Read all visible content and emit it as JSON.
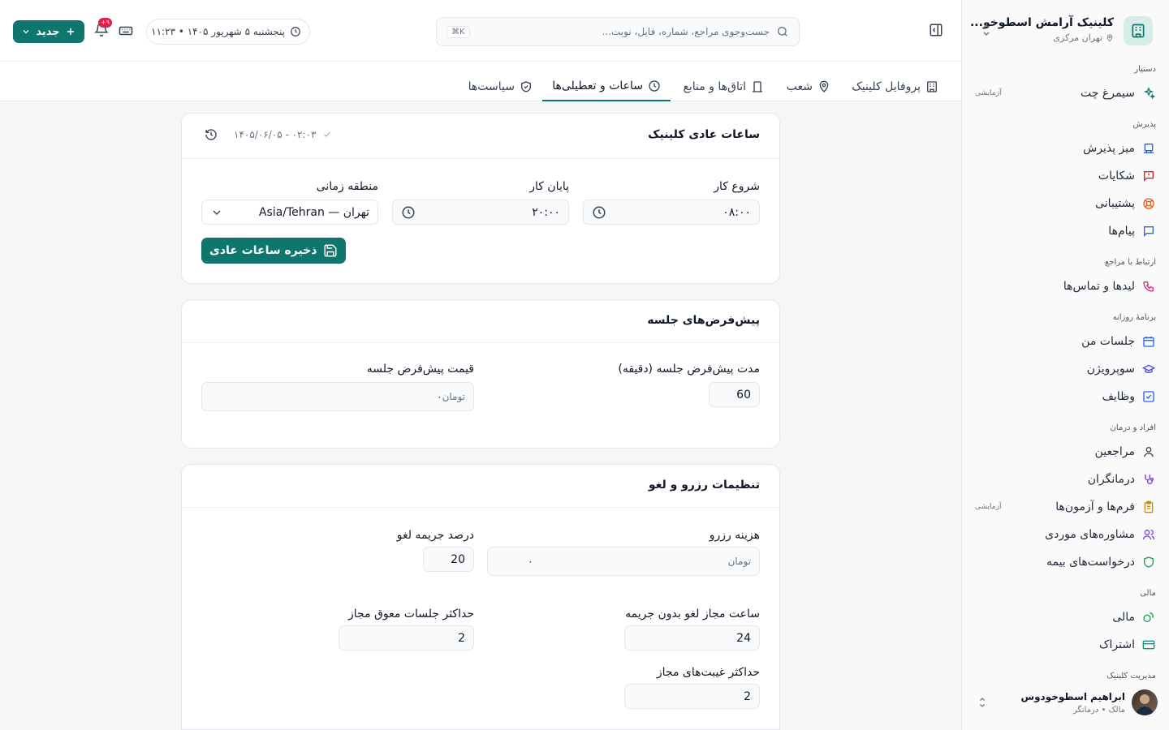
{
  "sidebar": {
    "brand_name": "کلینیک آرامش اسطوخو...",
    "brand_sub": "تهران مرکزی",
    "sections": [
      {
        "title": "دستیار",
        "items": [
          {
            "label": "سیمرغ چت",
            "badge": "آزمایشی",
            "icon": "sparkles-icon",
            "color": "#0f766e"
          }
        ]
      },
      {
        "title": "پذیرش",
        "items": [
          {
            "label": "میز پذیرش",
            "icon": "desk-icon",
            "color": "#2563eb"
          },
          {
            "label": "شکایات",
            "icon": "alert-message-icon",
            "color": "#dc2626"
          },
          {
            "label": "پشتیبانی",
            "icon": "lifebuoy-icon",
            "color": "#ea580c"
          },
          {
            "label": "پیام‌ها",
            "icon": "message-icon",
            "color": "#2563eb"
          }
        ]
      },
      {
        "title": "ارتباط با مراجع",
        "items": [
          {
            "label": "لیدها و تماس‌ها",
            "icon": "phone-icon",
            "color": "#db2777"
          }
        ]
      },
      {
        "title": "برنامهٔ روزانه",
        "items": [
          {
            "label": "جلسات من",
            "icon": "calendar-icon",
            "color": "#2563eb"
          },
          {
            "label": "سوپرویژن",
            "icon": "graduation-cap-icon",
            "color": "#4f46e5"
          },
          {
            "label": "وظایف",
            "icon": "checkbox-icon",
            "color": "#2563eb"
          }
        ]
      },
      {
        "title": "افراد و درمان",
        "items": [
          {
            "label": "مراجعین",
            "icon": "user-icon",
            "color": "#374151"
          },
          {
            "label": "درمانگران",
            "icon": "stethoscope-icon",
            "color": "#7c3aed"
          },
          {
            "label": "فرم‌ها و آزمون‌ها",
            "badge": "آزمایشی",
            "icon": "clipboard-icon",
            "color": "#ca8a04"
          },
          {
            "label": "مشاوره‌های موردی",
            "icon": "users-icon",
            "color": "#7c3aed"
          },
          {
            "label": "درخواست‌های بیمه",
            "icon": "shield-icon",
            "color": "#16a34a"
          }
        ]
      },
      {
        "title": "مالی",
        "items": [
          {
            "label": "مالی",
            "icon": "coins-icon",
            "color": "#16a34a"
          },
          {
            "label": "اشتراک",
            "icon": "credit-card-icon",
            "color": "#0d9488"
          }
        ]
      },
      {
        "title": "مدیریت کلینیک",
        "items": []
      }
    ],
    "user": {
      "name": "ابراهیم اسطوخودوس",
      "role": "مالک • درمانگر"
    }
  },
  "topbar": {
    "search_placeholder": "جست‌وجوی مراجع، شماره، فایل، نوبت...",
    "search_shortcut": "⌘K",
    "date_text": "پنجشنبه ۵ شهریور ۱۴۰۵ • ۱۱:۲۳",
    "notif_count": "۹+",
    "new_label": "جدید"
  },
  "tabs": [
    {
      "label": "پروفایل کلینیک",
      "icon": "building-icon",
      "active": false
    },
    {
      "label": "شعب",
      "icon": "map-pin-icon",
      "active": false
    },
    {
      "label": "اتاق‌ها و منابع",
      "icon": "door-icon",
      "active": false
    },
    {
      "label": "ساعات و تعطیلی‌ها",
      "icon": "clock-icon",
      "active": true
    },
    {
      "label": "سیاست‌ها",
      "icon": "shield-check-icon",
      "active": false
    }
  ],
  "hours_card": {
    "title": "ساعات عادی کلینیک",
    "last_saved": "۱۴۰۵/۰۶/۰۵ - ۰۲:۰۳",
    "start_label": "شروع کار",
    "start_value": "۰۸:۰۰",
    "end_label": "پایان کار",
    "end_value": "۲۰:۰۰",
    "tz_label": "منطقه زمانی",
    "tz_value": "تهران — Asia/Tehran",
    "save_label": "ذخیره ساعات عادی"
  },
  "session_card": {
    "title": "پیش‌فرض‌های جلسه",
    "duration_label": "مدت پیش‌فرض جلسه (دقیقه)",
    "duration_value": "60",
    "price_label": "قیمت پیش‌فرض جلسه",
    "price_value": "۰",
    "price_unit": "تومان"
  },
  "booking_card": {
    "title": "تنظیمات رزرو و لغو",
    "fee_label": "هزینه رزرو",
    "fee_value": "۰",
    "fee_unit": "تومان",
    "penalty_label": "درصد جریمه لغو",
    "penalty_value": "20",
    "free_cancel_label": "ساعت مجاز لغو بدون جریمه",
    "free_cancel_value": "24",
    "max_pending_label": "حداکثر جلسات معوق مجاز",
    "max_pending_value": "2",
    "max_absence_label": "حداکثر غیبت‌های مجاز",
    "max_absence_value": "2"
  }
}
